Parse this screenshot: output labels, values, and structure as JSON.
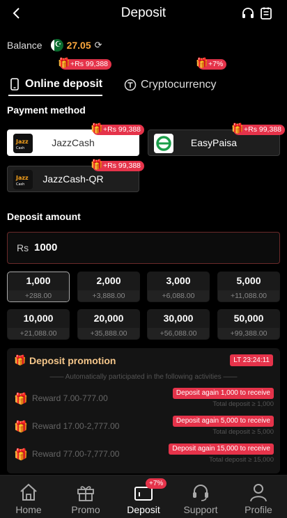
{
  "header": {
    "title": "Deposit"
  },
  "balance": {
    "label": "Balance",
    "amount": "27.05"
  },
  "tabs": [
    {
      "label": "Online deposit",
      "badge": "+Rs 99,388",
      "active": true
    },
    {
      "label": "Cryptocurrency",
      "badge": "+7%",
      "active": false
    }
  ],
  "payment": {
    "title": "Payment method",
    "methods": [
      {
        "name": "JazzCash",
        "badge": "+Rs 99,388",
        "selected": true
      },
      {
        "name": "EasyPaisa",
        "badge": "+Rs 99,388",
        "selected": false
      },
      {
        "name": "JazzCash-QR",
        "badge": "+Rs 99,388",
        "selected": false
      }
    ]
  },
  "deposit": {
    "title": "Deposit amount",
    "prefix": "Rs",
    "value": "1000",
    "options": [
      {
        "amount": "1,000",
        "bonus": "+288.00",
        "selected": true
      },
      {
        "amount": "2,000",
        "bonus": "+3,888.00"
      },
      {
        "amount": "3,000",
        "bonus": "+6,088.00"
      },
      {
        "amount": "5,000",
        "bonus": "+11,088.00"
      },
      {
        "amount": "10,000",
        "bonus": "+21,088.00"
      },
      {
        "amount": "20,000",
        "bonus": "+35,888.00"
      },
      {
        "amount": "30,000",
        "bonus": "+56,088.00"
      },
      {
        "amount": "50,000",
        "bonus": "+99,388.00"
      }
    ]
  },
  "promotion": {
    "title": "Deposit promotion",
    "timer": "LT 23:24:11",
    "subtitle": "—— Automatically participated in the following activities ——",
    "rewards": [
      {
        "label": "Reward 7.00-777.00",
        "button": "Deposit again 1,000 to receive",
        "total": "Total deposit ≥ 1,000"
      },
      {
        "label": "Reward 17.00-2,777.00",
        "button": "Deposit again 5,000 to receive",
        "total": "Total deposit ≥ 5,000"
      },
      {
        "label": "Reward 77.00-7,777.00",
        "button": "Deposit again 15,000 to receive",
        "total": "Total deposit ≥ 15,000"
      }
    ]
  },
  "nav": {
    "items": [
      {
        "label": "Home"
      },
      {
        "label": "Promo"
      },
      {
        "label": "Deposit",
        "badge": "+7%",
        "active": true
      },
      {
        "label": "Support"
      },
      {
        "label": "Profile"
      }
    ]
  },
  "colors": {
    "accent": "#e5334a",
    "gold": "#ffa93d",
    "background": "#000000"
  }
}
